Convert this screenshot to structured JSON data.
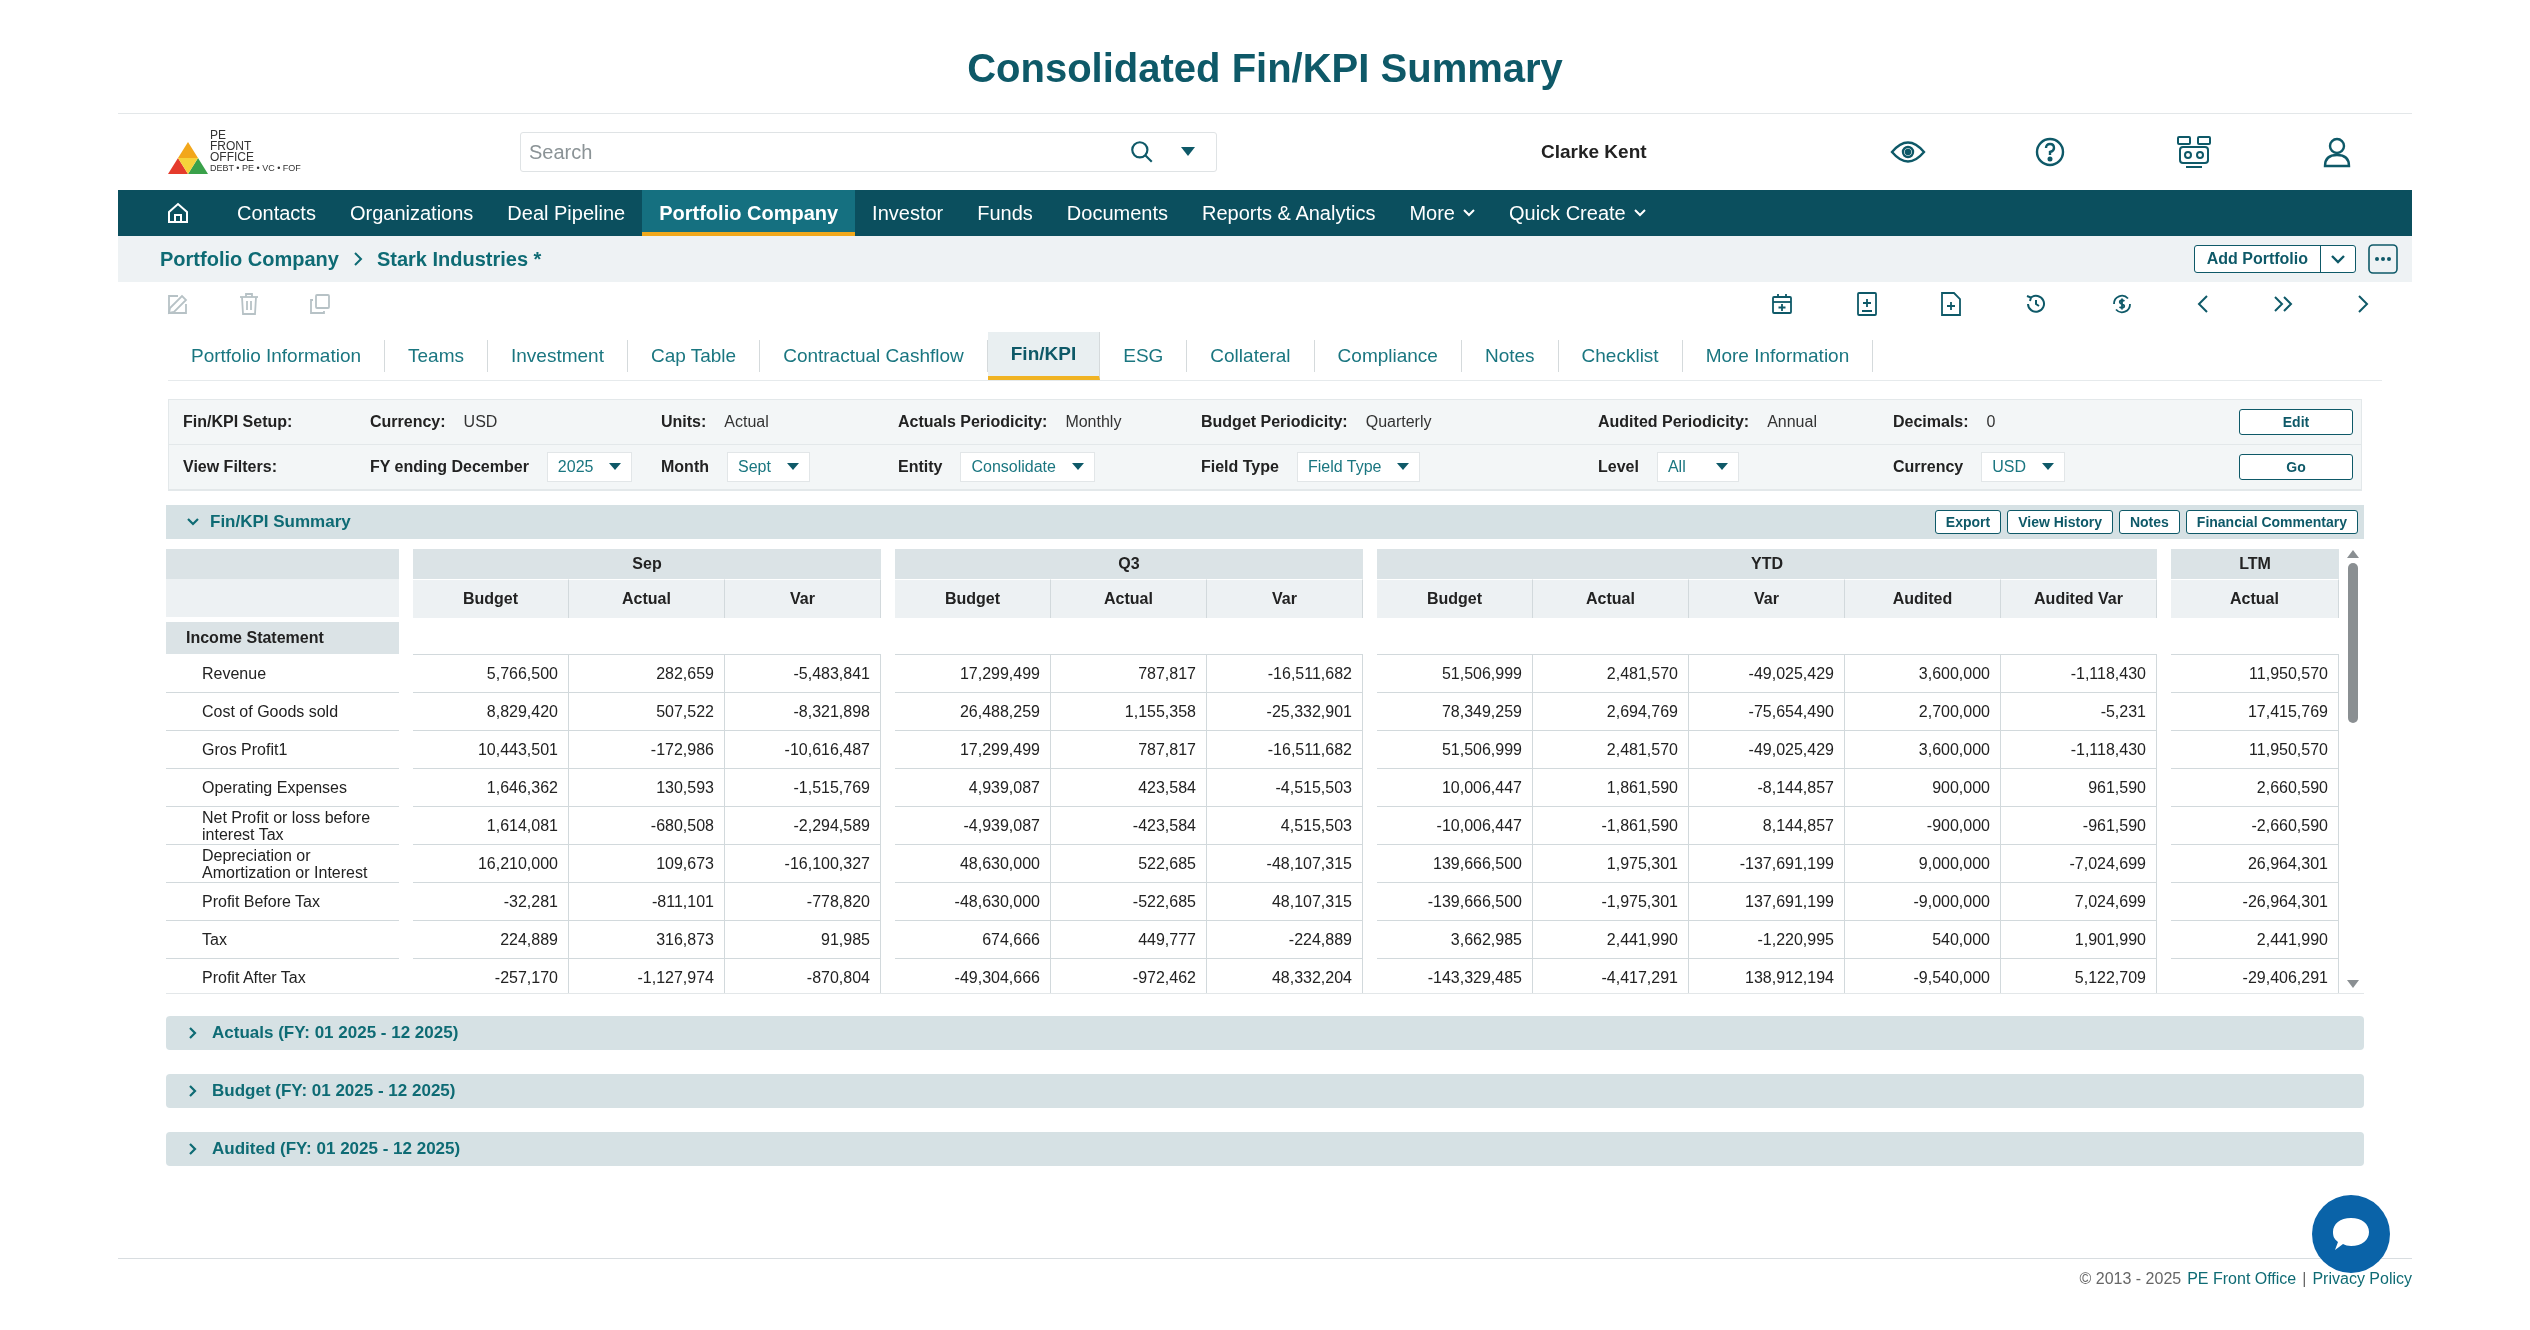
{
  "title": "Consolidated Fin/KPI Summary",
  "header": {
    "logo": {
      "lines": [
        "PE",
        "FRONT",
        "OFFICE"
      ],
      "tagline": "DEBT • PE • VC • FOF"
    },
    "search": {
      "placeholder": "Search"
    },
    "user": "Clarke Kent"
  },
  "nav": [
    {
      "label": "Contacts",
      "selected": false,
      "has_menu": false
    },
    {
      "label": "Organizations",
      "selected": false,
      "has_menu": false
    },
    {
      "label": "Deal Pipeline",
      "selected": false,
      "has_menu": false
    },
    {
      "label": "Portfolio Company",
      "selected": true,
      "has_menu": false
    },
    {
      "label": "Investor",
      "selected": false,
      "has_menu": false
    },
    {
      "label": "Funds",
      "selected": false,
      "has_menu": false
    },
    {
      "label": "Documents",
      "selected": false,
      "has_menu": false
    },
    {
      "label": "Reports & Analytics",
      "selected": false,
      "has_menu": false
    },
    {
      "label": "More",
      "selected": false,
      "has_menu": true
    },
    {
      "label": "Quick Create",
      "selected": false,
      "has_menu": true
    }
  ],
  "breadcrumb": [
    "Portfolio Company",
    "Stark Industries *"
  ],
  "add_button": "Add Portfolio",
  "tabs": [
    {
      "label": "Portfolio Information",
      "selected": false
    },
    {
      "label": "Teams",
      "selected": false
    },
    {
      "label": "Investment",
      "selected": false
    },
    {
      "label": "Cap Table",
      "selected": false
    },
    {
      "label": "Contractual Cashflow",
      "selected": false
    },
    {
      "label": "Fin/KPI",
      "selected": true
    },
    {
      "label": "ESG",
      "selected": false
    },
    {
      "label": "Collateral",
      "selected": false
    },
    {
      "label": "Compliance",
      "selected": false
    },
    {
      "label": "Notes",
      "selected": false
    },
    {
      "label": "Checklist",
      "selected": false
    },
    {
      "label": "More Information",
      "selected": false
    }
  ],
  "setup": {
    "heading": "Fin/KPI Setup:",
    "fields": [
      {
        "label": "Currency:",
        "value": "USD"
      },
      {
        "label": "Units:",
        "value": "Actual"
      },
      {
        "label": "Actuals Periodicity:",
        "value": "Monthly"
      },
      {
        "label": "Budget Periodicity:",
        "value": "Quarterly"
      },
      {
        "label": "Audited Periodicity:",
        "value": "Annual"
      },
      {
        "label": "Decimals:",
        "value": "0"
      }
    ],
    "button": "Edit"
  },
  "filters": {
    "heading": "View Filters:",
    "fields": [
      {
        "label": "FY ending December",
        "value": "2025"
      },
      {
        "label": "Month",
        "value": "Sept"
      },
      {
        "label": "Entity",
        "value": "Consolidate"
      },
      {
        "label": "Field Type",
        "value": "Field Type"
      },
      {
        "label": "Level",
        "value": "All"
      },
      {
        "label": "Currency",
        "value": "USD"
      }
    ],
    "button": "Go"
  },
  "summary": {
    "title": "Fin/KPI Summary",
    "expanded": true,
    "buttons": [
      "Export",
      "View History",
      "Notes",
      "Financial Commentary"
    ],
    "table": {
      "groups": [
        {
          "name": "Sep",
          "columns": [
            "Budget",
            "Actual",
            "Var"
          ]
        },
        {
          "name": "Q3",
          "columns": [
            "Budget",
            "Actual",
            "Var"
          ]
        },
        {
          "name": "YTD",
          "columns": [
            "Budget",
            "Actual",
            "Var",
            "Audited",
            "Audited Var"
          ]
        },
        {
          "name": "LTM",
          "columns": [
            "Actual"
          ]
        }
      ],
      "sections": [
        {
          "name": "Income Statement",
          "rows": [
            {
              "label": "Revenue",
              "values": [
                "5,766,500",
                "282,659",
                "-5,483,841",
                "17,299,499",
                "787,817",
                "-16,511,682",
                "51,506,999",
                "2,481,570",
                "-49,025,429",
                "3,600,000",
                "-1,118,430",
                "11,950,570"
              ]
            },
            {
              "label": "Cost of Goods sold",
              "values": [
                "8,829,420",
                "507,522",
                "-8,321,898",
                "26,488,259",
                "1,155,358",
                "-25,332,901",
                "78,349,259",
                "2,694,769",
                "-75,654,490",
                "2,700,000",
                "-5,231",
                "17,415,769"
              ]
            },
            {
              "label": "Gros Profit1",
              "values": [
                "10,443,501",
                "-172,986",
                "-10,616,487",
                "17,299,499",
                "787,817",
                "-16,511,682",
                "51,506,999",
                "2,481,570",
                "-49,025,429",
                "3,600,000",
                "-1,118,430",
                "11,950,570"
              ]
            },
            {
              "label": "Operating Expenses",
              "values": [
                "1,646,362",
                "130,593",
                "-1,515,769",
                "4,939,087",
                "423,584",
                "-4,515,503",
                "10,006,447",
                "1,861,590",
                "-8,144,857",
                "900,000",
                "961,590",
                "2,660,590"
              ]
            },
            {
              "label": "Net Profit or loss before interest Tax",
              "values": [
                "1,614,081",
                "-680,508",
                "-2,294,589",
                "-4,939,087",
                "-423,584",
                "4,515,503",
                "-10,006,447",
                "-1,861,590",
                "8,144,857",
                "-900,000",
                "-961,590",
                "-2,660,590"
              ]
            },
            {
              "label": "Depreciation or Amortization or Interest",
              "values": [
                "16,210,000",
                "109,673",
                "-16,100,327",
                "48,630,000",
                "522,685",
                "-48,107,315",
                "139,666,500",
                "1,975,301",
                "-137,691,199",
                "9,000,000",
                "-7,024,699",
                "26,964,301"
              ]
            },
            {
              "label": "Profit Before Tax",
              "values": [
                "-32,281",
                "-811,101",
                "-778,820",
                "-48,630,000",
                "-522,685",
                "48,107,315",
                "-139,666,500",
                "-1,975,301",
                "137,691,199",
                "-9,000,000",
                "7,024,699",
                "-26,964,301"
              ]
            },
            {
              "label": "Tax",
              "values": [
                "224,889",
                "316,873",
                "91,985",
                "674,666",
                "449,777",
                "-224,889",
                "3,662,985",
                "2,441,990",
                "-1,220,995",
                "540,000",
                "1,901,990",
                "2,441,990"
              ]
            },
            {
              "label": "Profit After Tax",
              "values": [
                "-257,170",
                "-1,127,974",
                "-870,804",
                "-49,304,666",
                "-972,462",
                "48,332,204",
                "-143,329,485",
                "-4,417,291",
                "138,912,194",
                "-9,540,000",
                "5,122,709",
                "-29,406,291"
              ]
            }
          ]
        }
      ]
    }
  },
  "panels": [
    {
      "title": "Actuals (FY: 01 2025 - 12 2025)",
      "expanded": false
    },
    {
      "title": "Budget (FY: 01 2025 - 12 2025)",
      "expanded": false
    },
    {
      "title": "Audited (FY: 01 2025 - 12 2025)",
      "expanded": false
    }
  ],
  "footer": {
    "copyright": "© 2013 - 2025",
    "company_link": "PE Front Office",
    "separator": "|",
    "privacy_link": "Privacy Policy"
  }
}
